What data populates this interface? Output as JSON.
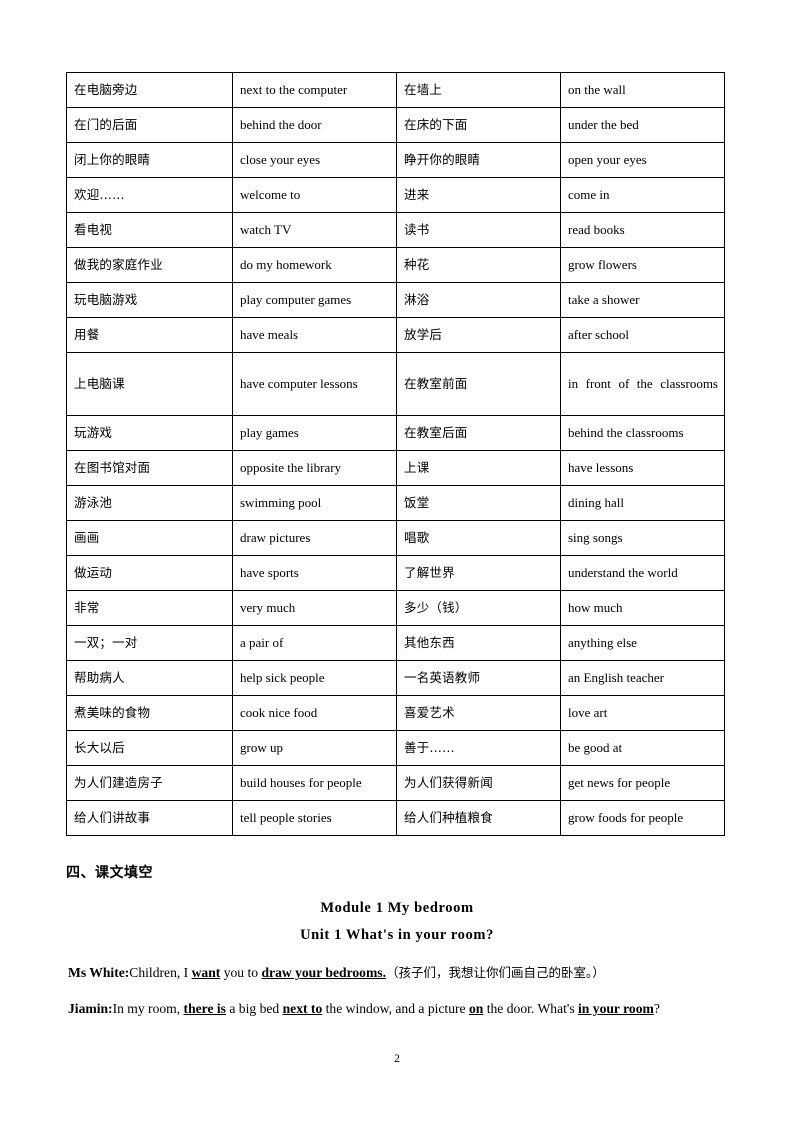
{
  "document": {
    "page_number": "2"
  },
  "vocab_table": {
    "rows": [
      {
        "cn1": "在电脑旁边",
        "en1": "next to the computer",
        "cn2": "在墙上",
        "en2": "on the wall",
        "tall": false,
        "justify2": false
      },
      {
        "cn1": "在门的后面",
        "en1": "behind the door",
        "cn2": "在床的下面",
        "en2": "under the bed",
        "tall": false,
        "justify2": false
      },
      {
        "cn1": "闭上你的眼睛",
        "en1": "close your eyes",
        "cn2": "睁开你的眼睛",
        "en2": "open your eyes",
        "tall": false,
        "justify2": false
      },
      {
        "cn1": "欢迎……",
        "en1": "welcome to",
        "cn2": "进来",
        "en2": "come in",
        "tall": false,
        "justify2": false
      },
      {
        "cn1": "看电视",
        "en1": "watch TV",
        "cn2": "读书",
        "en2": "read books",
        "tall": false,
        "justify2": false
      },
      {
        "cn1": "做我的家庭作业",
        "en1": "do my homework",
        "cn2": "种花",
        "en2": "grow flowers",
        "tall": false,
        "justify2": false
      },
      {
        "cn1": "玩电脑游戏",
        "en1": "play computer games",
        "cn2": "淋浴",
        "en2": "take a shower",
        "tall": false,
        "justify2": false
      },
      {
        "cn1": "用餐",
        "en1": "have meals",
        "cn2": "放学后",
        "en2": "after school",
        "tall": false,
        "justify2": false
      },
      {
        "cn1": "上电脑课",
        "en1": "have computer lessons",
        "cn2": "在教室前面",
        "en2": "in front of the classrooms",
        "tall": true,
        "justify2": true
      },
      {
        "cn1": "玩游戏",
        "en1": "play games",
        "cn2": "在教室后面",
        "en2": "behind the classrooms",
        "tall": false,
        "justify2": false
      },
      {
        "cn1": "在图书馆对面",
        "en1": "opposite the library",
        "cn2": "上课",
        "en2": "have lessons",
        "tall": false,
        "justify2": false
      },
      {
        "cn1": "游泳池",
        "en1": "swimming pool",
        "cn2": "饭堂",
        "en2": "dining hall",
        "tall": false,
        "justify2": false
      },
      {
        "cn1": "画画",
        "en1": "draw pictures",
        "cn2": "唱歌",
        "en2": "sing songs",
        "tall": false,
        "justify2": false
      },
      {
        "cn1": "做运动",
        "en1": "have sports",
        "cn2": "了解世界",
        "en2": "understand the world",
        "tall": false,
        "justify2": false
      },
      {
        "cn1": "非常",
        "en1": "very much",
        "cn2": "多少（钱）",
        "en2": "how much",
        "tall": false,
        "justify2": false
      },
      {
        "cn1": "一双；一对",
        "en1": "a pair of",
        "cn2": "其他东西",
        "en2": "anything else",
        "tall": false,
        "justify2": false
      },
      {
        "cn1": "帮助病人",
        "en1": "help sick people",
        "cn2": "一名英语教师",
        "en2": "an English teacher",
        "tall": false,
        "justify2": false
      },
      {
        "cn1": "煮美味的食物",
        "en1": "cook nice food",
        "cn2": "喜爱艺术",
        "en2": "love art",
        "tall": false,
        "justify2": false
      },
      {
        "cn1": "长大以后",
        "en1": "grow up",
        "cn2": "善于……",
        "en2": "be good at",
        "tall": false,
        "justify2": false
      },
      {
        "cn1": "为人们建造房子",
        "en1": "build houses for people",
        "cn2": "为人们获得新闻",
        "en2": "get news for people",
        "tall": false,
        "justify2": false
      },
      {
        "cn1": "给人们讲故事",
        "en1": "tell people stories",
        "cn2": "给人们种植粮食",
        "en2": "grow foods for people",
        "tall": false,
        "justify2": false
      }
    ]
  },
  "section": {
    "heading": "四、课文填空",
    "module_title": "Module 1 My bedroom",
    "unit_title": "Unit 1 What's in your room?"
  },
  "dialogue": {
    "line1": {
      "speaker": "Ms White:",
      "seg1": "Children, I ",
      "key1": "want",
      "seg2": " you to ",
      "key2": "draw your bedrooms.",
      "translation": "（孩子们，我想让你们画自己的卧室。）"
    },
    "line2": {
      "speaker": "Jiamin:",
      "seg1": "In my room, ",
      "key1": "there is",
      "seg2": " a big bed ",
      "key2": "next to",
      "seg3": " the window, and a picture ",
      "key3": "on",
      "seg4": " the door. What's ",
      "key4": "in your room",
      "seg5": "?"
    }
  }
}
